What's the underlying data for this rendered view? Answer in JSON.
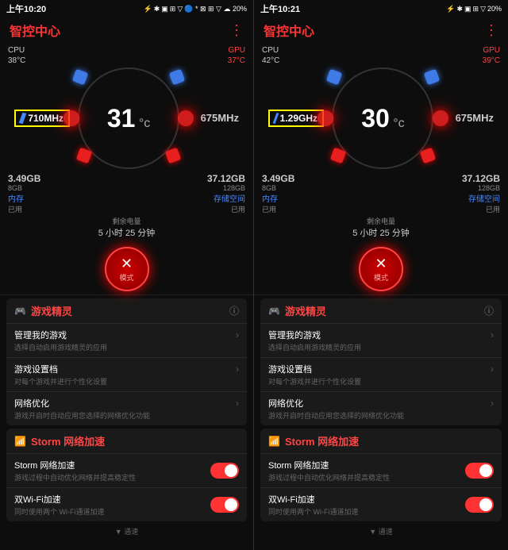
{
  "panel1": {
    "statusBar": {
      "time": "上午10:20",
      "icons": "🔵 * ⊠ ⊞ ▽ ☁ 20%"
    },
    "title": "智控中心",
    "cpu": {
      "label": "CPU",
      "temp": "38°C",
      "freq": "710MHz"
    },
    "gpu": {
      "label": "GPU",
      "temp": "37°C",
      "freq": "675MHz"
    },
    "tempDisplay": "31",
    "tempUnit": "c",
    "memory": {
      "used": "3.49GB",
      "total": "8GB",
      "label": "内存",
      "sublabel": "已用"
    },
    "storage": {
      "used": "37.12GB",
      "total": "128GB",
      "label": "存储空间",
      "sublabel": "已用"
    },
    "battery": {
      "label": "剩余电量",
      "time": "5 小时 25 分钟"
    },
    "modeButton": "模式",
    "modeIcon": "✕",
    "gameElf": {
      "sectionTitle": "游戏精灵",
      "items": [
        {
          "title": "管理我的游戏",
          "desc": "选择自动启用游戏精灵的应用"
        },
        {
          "title": "游戏设置档",
          "desc": "对每个游戏并进行个性化设置"
        },
        {
          "title": "网络优化",
          "desc": "游戏开启时自动应用您选择的网络优化功能"
        }
      ]
    },
    "storm": {
      "sectionTitle": "Storm 网络加速",
      "items": [
        {
          "title": "Storm 网络加速",
          "desc": "游戏过程中自动优化网络并提高稳定性",
          "toggled": true
        },
        {
          "title": "双Wi-Fi加速",
          "desc": "同时使用两个 Wi-Fi通道加速",
          "toggled": true
        }
      ]
    }
  },
  "panel2": {
    "statusBar": {
      "time": "上午10:21",
      "icons": "🔵 * ⊠ ⊞ ▽ ☁ 20%"
    },
    "title": "智控中心",
    "cpu": {
      "label": "CPU",
      "temp": "42°C",
      "freq": "1.29GHz"
    },
    "gpu": {
      "label": "GPU",
      "temp": "39°C",
      "freq": "675MHz"
    },
    "tempDisplay": "30",
    "tempUnit": "c",
    "memory": {
      "used": "3.49GB",
      "total": "8GB",
      "label": "内存",
      "sublabel": "已用"
    },
    "storage": {
      "used": "37.12GB",
      "total": "128GB",
      "label": "存储空间",
      "sublabel": "已用"
    },
    "battery": {
      "label": "剩余电量",
      "time": "5 小时 25 分钟"
    },
    "modeButton": "模式",
    "modeIcon": "✕",
    "gameElf": {
      "sectionTitle": "游戏精灵",
      "items": [
        {
          "title": "管理我的游戏",
          "desc": "选择自动启用游戏精灵的应用"
        },
        {
          "title": "游戏设置档",
          "desc": "对每个游戏并进行个性化设置"
        },
        {
          "title": "网络优化",
          "desc": "游戏开启时自动应用您选择的网络优化功能"
        }
      ]
    },
    "storm": {
      "sectionTitle": "Storm 网络加速",
      "items": [
        {
          "title": "Storm 网络加速",
          "desc": "游戏过程中自动优化网络并提高稳定性",
          "toggled": true
        },
        {
          "title": "双Wi-Fi加速",
          "desc": "同时使用两个 Wi-Fi通道加速",
          "toggled": true
        }
      ]
    }
  },
  "colors": {
    "accent": "#ff3333",
    "blue": "#4488ff",
    "text": "#ffffff",
    "subtext": "#888888"
  }
}
